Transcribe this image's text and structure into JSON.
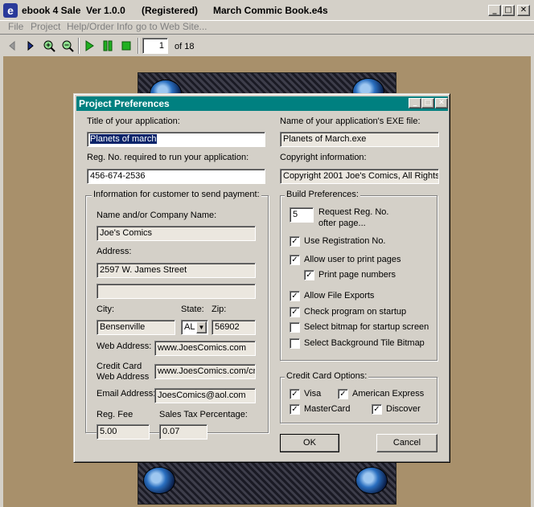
{
  "window": {
    "title_parts": [
      "ebook 4 Sale  Ver 1.0.0",
      "(Registered)",
      "March Commic Book.e4s"
    ],
    "icon_letter": "e"
  },
  "menu": [
    "File",
    "Project",
    "Help/Order Info",
    "go to Web Site..."
  ],
  "toolbar": {
    "page": "1",
    "of_label": "of 18"
  },
  "dialog": {
    "title": "Project Preferences",
    "left": {
      "title_label": "Title of your application:",
      "title_value": "Planets of march",
      "regno_label": "Reg. No. required to run your application:",
      "regno_value": "456-674-2536",
      "group_label": "Information for customer to send payment:",
      "name_label": "Name and/or Company Name:",
      "name_value": "Joe's Comics",
      "address_label": "Address:",
      "address1": "2597 W. James Street",
      "address2": "",
      "city_label": "City:",
      "city_value": "Bensenville",
      "state_label": "State:",
      "state_value": "AL",
      "zip_label": "Zip:",
      "zip_value": "56902",
      "web_label": "Web Address:",
      "web_value": "www.JoesComics.com",
      "cc_label_1": "Credit Card",
      "cc_label_2": "Web Address",
      "cc_value": "www.JoesComics.com/cr",
      "email_label": "Email Address:",
      "email_value": "JoesComics@aol.com",
      "fee_label": "Reg. Fee",
      "fee_value": "5.00",
      "tax_label": "Sales Tax Percentage:",
      "tax_value": "0.07"
    },
    "right": {
      "exe_label": "Name of your application's EXE file:",
      "exe_value": "Planets of March.exe",
      "copy_label": "Copyright information:",
      "copy_value": "Copyright 2001 Joe's Comics, All Rights",
      "build_label": "Build Preferences:",
      "request_value": "5",
      "request_label_1": "Request Reg. No.",
      "request_label_2": "ofter page...",
      "options": [
        {
          "label": "Use Registration No.",
          "checked": true
        },
        {
          "label": "Allow user to print pages",
          "checked": true
        },
        {
          "label": "Print page numbers",
          "checked": true
        },
        {
          "label": "Allow File Exports",
          "checked": true
        },
        {
          "label": "Check program on startup",
          "checked": true
        },
        {
          "label": "Select bitmap for startup screen",
          "checked": false
        },
        {
          "label": "Select Background Tile Bitmap",
          "checked": false
        }
      ],
      "cc_group_label": "Credit Card Options:",
      "cards": [
        {
          "label": "Visa",
          "checked": true
        },
        {
          "label": "American Express",
          "checked": true
        },
        {
          "label": "MasterCard",
          "checked": true
        },
        {
          "label": "Discover",
          "checked": true
        }
      ]
    },
    "ok_label": "OK",
    "cancel_label": "Cancel"
  }
}
